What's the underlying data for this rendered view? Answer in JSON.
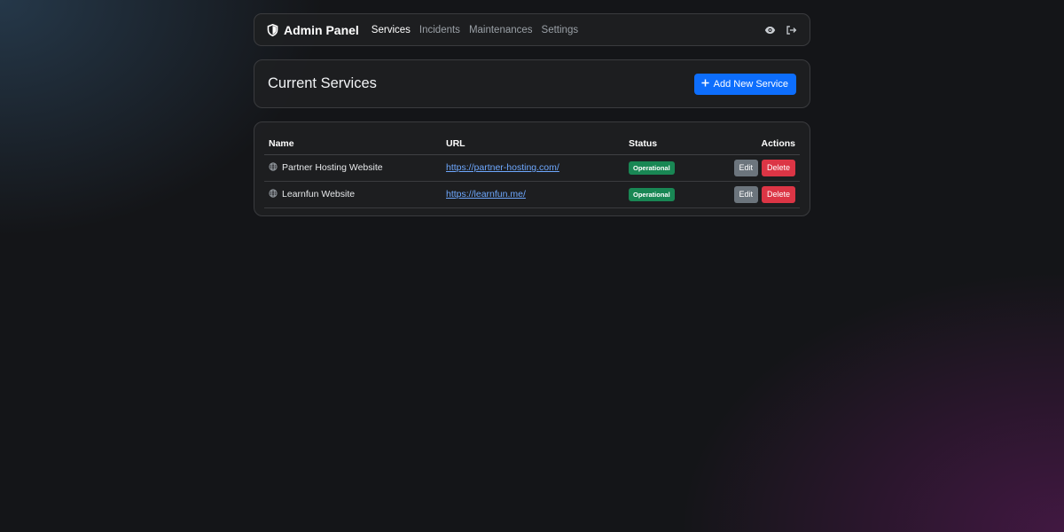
{
  "navbar": {
    "brand": "Admin Panel",
    "brand_icon": "shield-icon",
    "links": [
      {
        "label": "Services",
        "active": true
      },
      {
        "label": "Incidents",
        "active": false
      },
      {
        "label": "Maintenances",
        "active": false
      },
      {
        "label": "Settings",
        "active": false
      }
    ],
    "right_icons": [
      "eye-icon",
      "logout-icon"
    ]
  },
  "header": {
    "title": "Current Services",
    "add_button": "Add New Service"
  },
  "table": {
    "columns": [
      "Name",
      "URL",
      "Status",
      "Actions"
    ],
    "rows": [
      {
        "name": "Partner Hosting Website",
        "url": "https://partner-hosting.com/",
        "status": "Operational",
        "edit": "Edit",
        "delete": "Delete"
      },
      {
        "name": "Learnfun Website",
        "url": "https://learnfun.me/",
        "status": "Operational",
        "edit": "Edit",
        "delete": "Delete"
      }
    ]
  },
  "colors": {
    "primary": "#0d6efd",
    "success": "#198754",
    "danger": "#dc3545",
    "secondary": "#6c757d",
    "link": "#6ea8fe"
  }
}
